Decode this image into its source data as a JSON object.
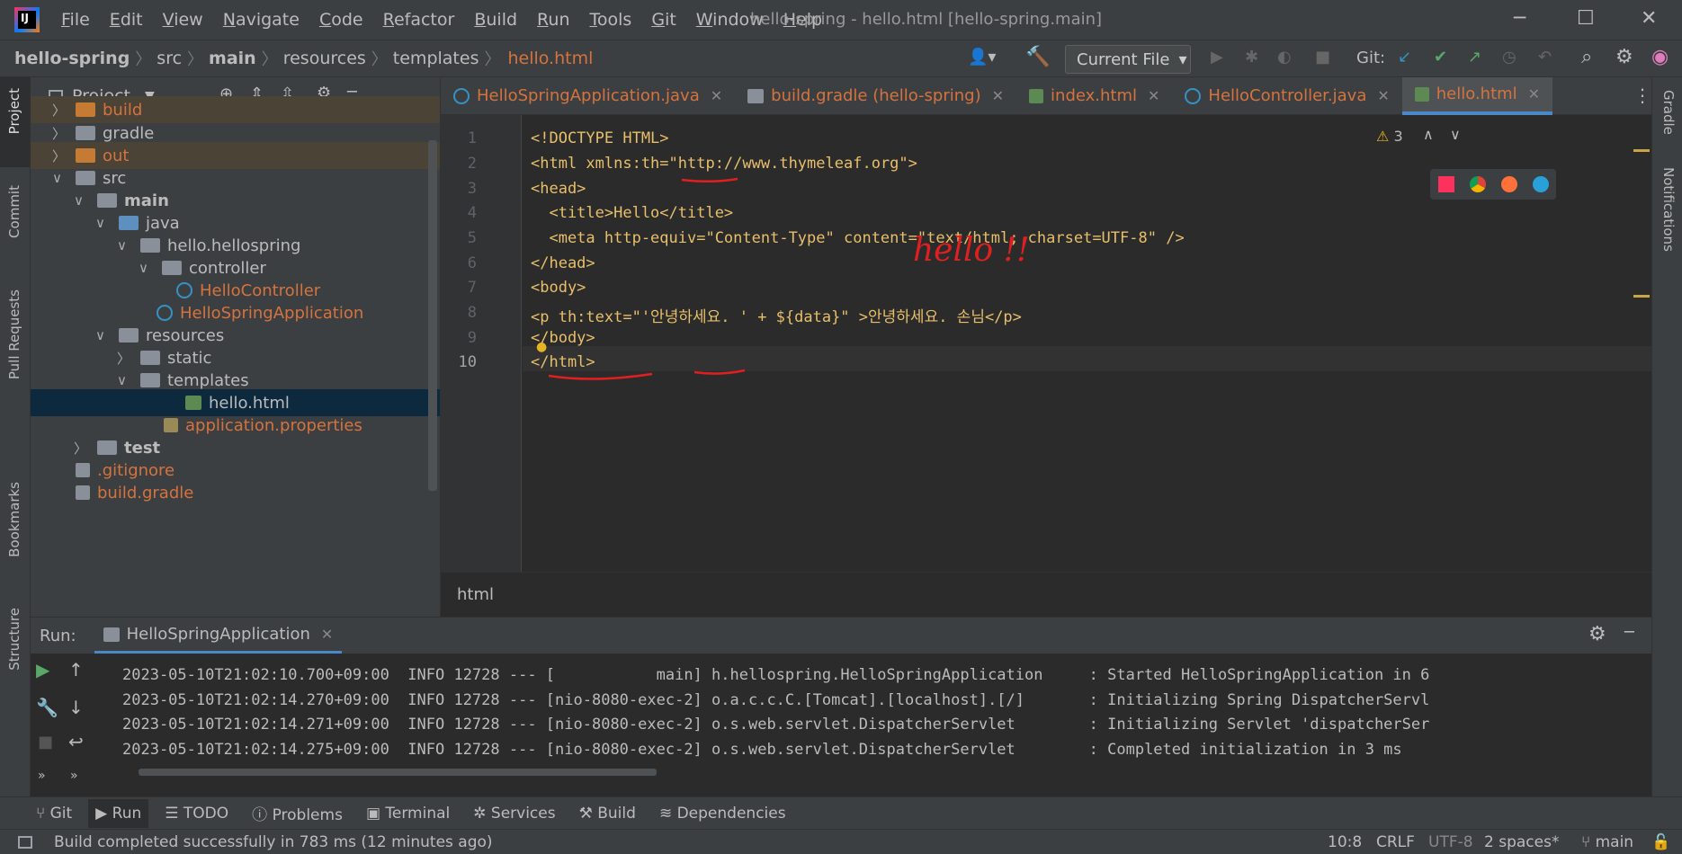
{
  "menu": [
    "File",
    "Edit",
    "View",
    "Navigate",
    "Code",
    "Refactor",
    "Build",
    "Run",
    "Tools",
    "Git",
    "Window",
    "Help"
  ],
  "window_title": "hello-spring - hello.html [hello-spring.main]",
  "breadcrumb": [
    "hello-spring",
    "src",
    "main",
    "resources",
    "templates",
    "hello.html"
  ],
  "toolbar": {
    "run_config": "Current File",
    "git_label": "Git:"
  },
  "left_strip": [
    "Project",
    "Commit",
    "Pull Requests",
    "Bookmarks",
    "Structure"
  ],
  "right_strip": [
    "Gradle",
    "Notifications"
  ],
  "project_panel": {
    "title": "Project",
    "tree": [
      {
        "label": "build",
        "color": "orange"
      },
      {
        "label": "gradle"
      },
      {
        "label": "out",
        "color": "orange"
      },
      {
        "label": "src"
      },
      {
        "label": "main"
      },
      {
        "label": "java"
      },
      {
        "label": "hello.hellospring"
      },
      {
        "label": "controller"
      },
      {
        "label": "HelloController",
        "color": "orange"
      },
      {
        "label": "HelloSpringApplication",
        "color": "orange"
      },
      {
        "label": "resources"
      },
      {
        "label": "static"
      },
      {
        "label": "templates"
      },
      {
        "label": "hello.html"
      },
      {
        "label": "application.properties",
        "color": "orange"
      },
      {
        "label": "test"
      },
      {
        "label": ".gitignore",
        "color": "orange"
      },
      {
        "label": "build.gradle",
        "color": "orange"
      }
    ]
  },
  "tabs": [
    "HelloSpringApplication.java",
    "build.gradle (hello-spring)",
    "index.html",
    "HelloController.java",
    "hello.html"
  ],
  "editor": {
    "warning_count": "3",
    "line_numbers": [
      "1",
      "2",
      "3",
      "4",
      "5",
      "6",
      "7",
      "8",
      "9",
      "10"
    ],
    "lines": [
      "<!DOCTYPE HTML>",
      "<html xmlns:th=\"http://www.thymeleaf.org\">",
      "<head>",
      "  <title>Hello</title>",
      "  <meta http-equiv=\"Content-Type\" content=\"text/html; charset=UTF-8\" />",
      "</head>",
      "<body>",
      "<p th:text=\"'안녕하세요. ' + ${data}\" >안녕하세요. 손님</p>",
      "</body>",
      "</html>"
    ],
    "annotation": "hello !!",
    "breadcrumb": "html"
  },
  "run_panel": {
    "label": "Run:",
    "tab": "HelloSpringApplication",
    "log": [
      "2023-05-10T21:02:10.700+09:00  INFO 12728 --- [           main] h.hellospring.HelloSpringApplication     : Started HelloSpringApplication in 6",
      "2023-05-10T21:02:14.270+09:00  INFO 12728 --- [nio-8080-exec-2] o.a.c.c.C.[Tomcat].[localhost].[/]       : Initializing Spring DispatcherServl",
      "2023-05-10T21:02:14.271+09:00  INFO 12728 --- [nio-8080-exec-2] o.s.web.servlet.DispatcherServlet        : Initializing Servlet 'dispatcherSer",
      "2023-05-10T21:02:14.275+09:00  INFO 12728 --- [nio-8080-exec-2] o.s.web.servlet.DispatcherServlet        : Completed initialization in 3 ms"
    ]
  },
  "bottom_tools": [
    "Git",
    "Run",
    "TODO",
    "Problems",
    "Terminal",
    "Services",
    "Build",
    "Dependencies"
  ],
  "status": {
    "message": "Build completed successfully in 783 ms (12 minutes ago)",
    "position": "10:8",
    "line_sep": "CRLF",
    "encoding": "UTF-8",
    "indent": "2 spaces*",
    "branch": "main"
  }
}
